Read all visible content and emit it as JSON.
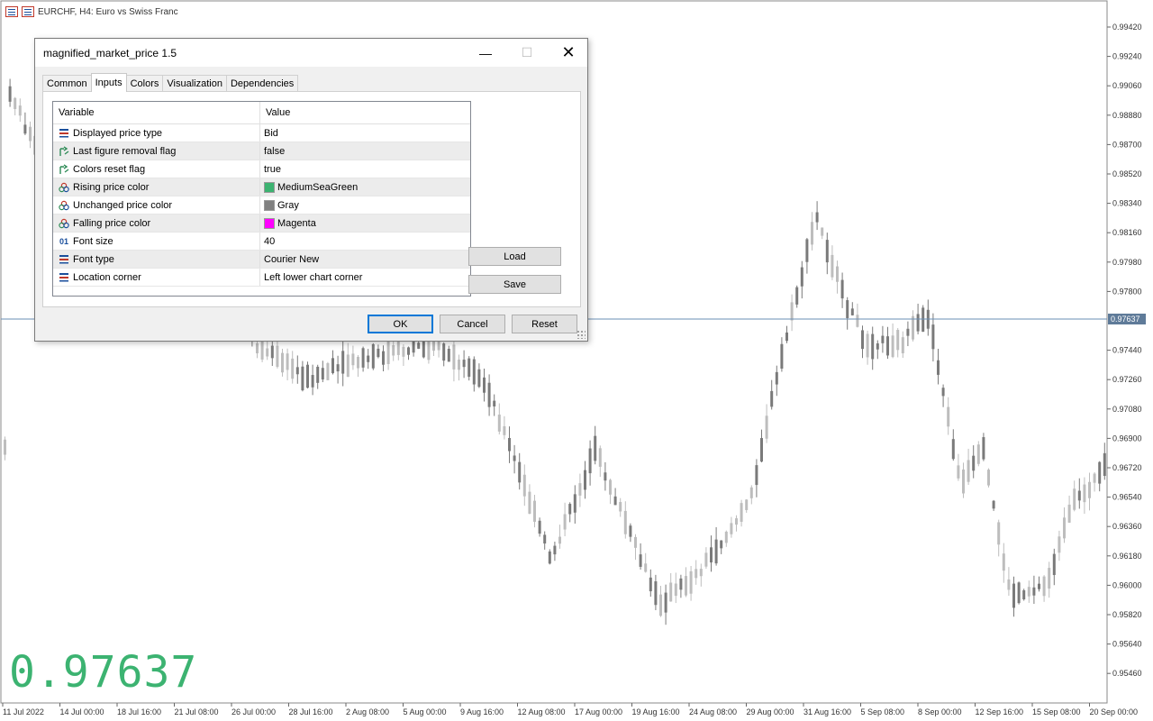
{
  "chart": {
    "title": "EURCHF, H4:  Euro vs Swiss Franc",
    "current_price_label": "0.97637",
    "magnified_price": "0.97637",
    "price_labels": [
      "0.99420",
      "0.99240",
      "0.99060",
      "0.98880",
      "0.98700",
      "0.98520",
      "0.98340",
      "0.98160",
      "0.97980",
      "0.97800",
      "0.97440",
      "0.97260",
      "0.97080",
      "0.96900",
      "0.96720",
      "0.96540",
      "0.96360",
      "0.96180",
      "0.96000",
      "0.95820",
      "0.95640",
      "0.95460"
    ],
    "date_labels": [
      "11 Jul 2022",
      "14 Jul 00:00",
      "18 Jul 16:00",
      "21 Jul 08:00",
      "26 Jul 00:00",
      "28 Jul 16:00",
      "2 Aug 08:00",
      "5 Aug 00:00",
      "9 Aug 16:00",
      "12 Aug 08:00",
      "17 Aug 00:00",
      "19 Aug 16:00",
      "24 Aug 08:00",
      "29 Aug 00:00",
      "31 Aug 16:00",
      "5 Sep 08:00",
      "8 Sep 00:00",
      "12 Sep 16:00",
      "15 Sep 08:00",
      "20 Sep 00:00"
    ],
    "colors": {
      "bull": "#bdbdbd",
      "bear": "#7a7a7a",
      "line": "#6a8fb5",
      "magnified": "#3cb371"
    }
  },
  "dialog": {
    "title": "magnified_market_price 1.5",
    "tabs": [
      "Common",
      "Inputs",
      "Colors",
      "Visualization",
      "Dependencies"
    ],
    "active_tab": "Inputs",
    "columns": [
      "Variable",
      "Value"
    ],
    "rows": [
      {
        "icon": "enum-icon",
        "variable": "Displayed price type",
        "value": "Bid"
      },
      {
        "icon": "bool-icon",
        "variable": "Last figure removal flag",
        "value": "false"
      },
      {
        "icon": "bool-icon",
        "variable": "Colors reset flag",
        "value": "true"
      },
      {
        "icon": "color-icon",
        "variable": "Rising price color",
        "value": "MediumSeaGreen",
        "swatch": "#3cb371"
      },
      {
        "icon": "color-icon",
        "variable": "Unchanged price color",
        "value": "Gray",
        "swatch": "#808080"
      },
      {
        "icon": "color-icon",
        "variable": "Falling price color",
        "value": "Magenta",
        "swatch": "#ff00ff"
      },
      {
        "icon": "int-icon",
        "variable": "Font size",
        "value": "40"
      },
      {
        "icon": "enum-icon",
        "variable": "Font type",
        "value": "Courier New"
      },
      {
        "icon": "enum-icon",
        "variable": "Location corner",
        "value": "Left lower chart corner"
      }
    ],
    "buttons": {
      "load": "Load",
      "save": "Save",
      "ok": "OK",
      "cancel": "Cancel",
      "reset": "Reset"
    },
    "window_controls": {
      "minimize": "—",
      "maximize": "☐",
      "close": "✕"
    },
    "int_icon_glyph": "01"
  }
}
